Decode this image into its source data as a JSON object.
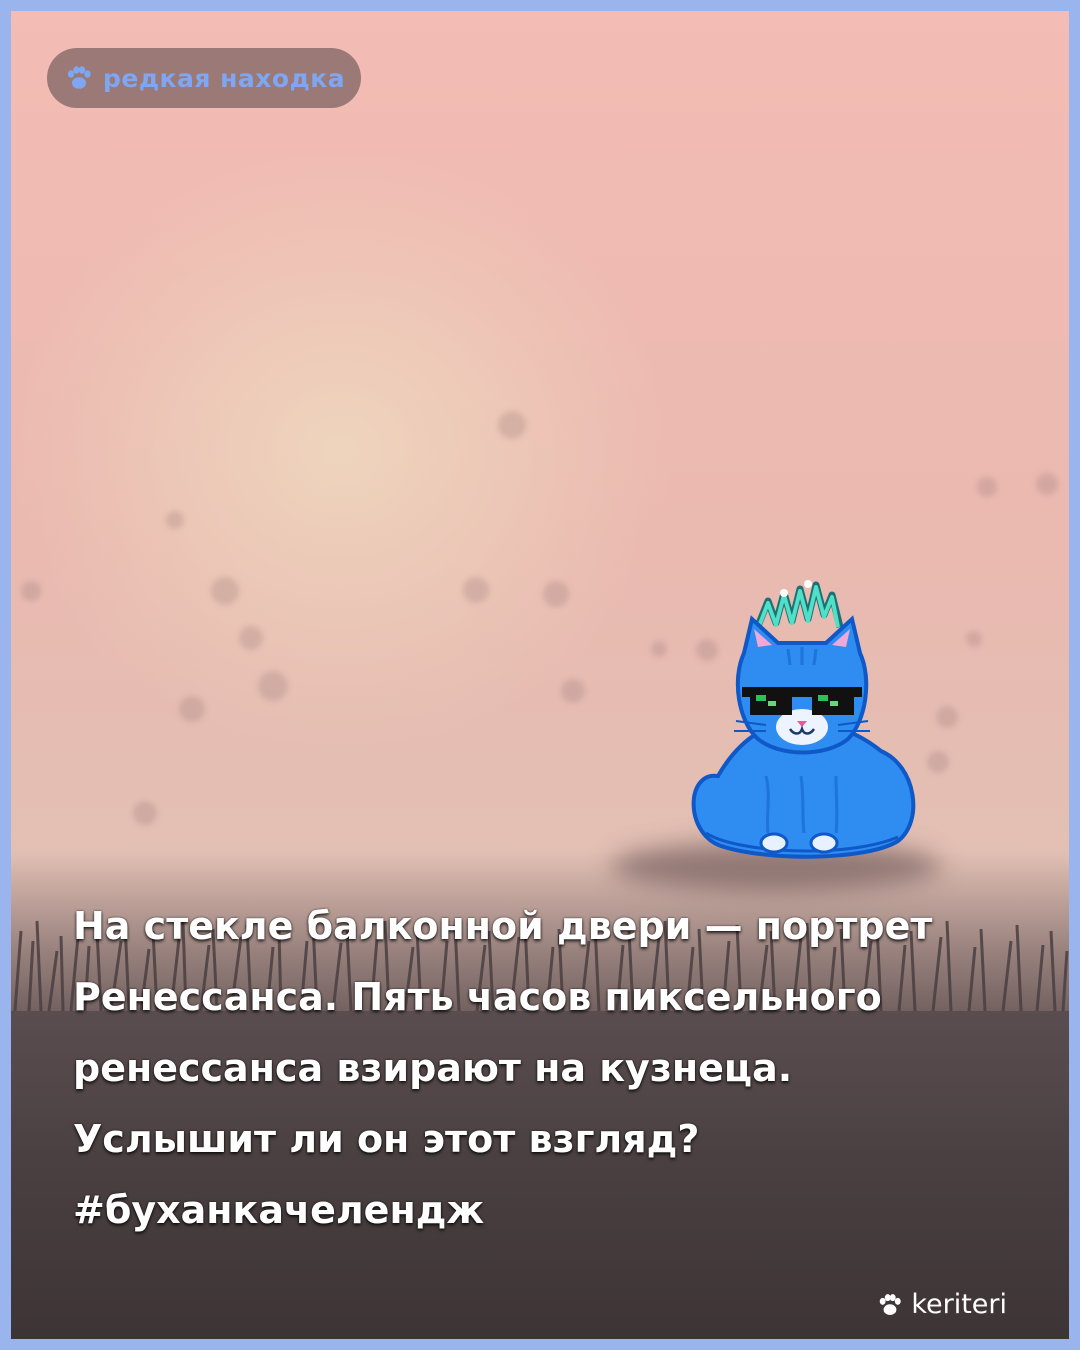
{
  "badge": {
    "icon": "paw-icon",
    "label": "редкая находка"
  },
  "caption": {
    "lines": [
      "На стекле балконной двери — портрет",
      "Ренессанса. Пять часов пиксельного",
      "ренессанса взирают на кузнеца.",
      "Услышит ли он этот взгляд?",
      "#буханкачелендж"
    ]
  },
  "watermark": {
    "icon": "paw-icon",
    "label": "keriteri"
  },
  "colors": {
    "frame_border": "#9ab4ee",
    "badge_text": "#7ea6f2",
    "cat_body": "#2f8cf0",
    "crest": "#3fd4c0"
  }
}
